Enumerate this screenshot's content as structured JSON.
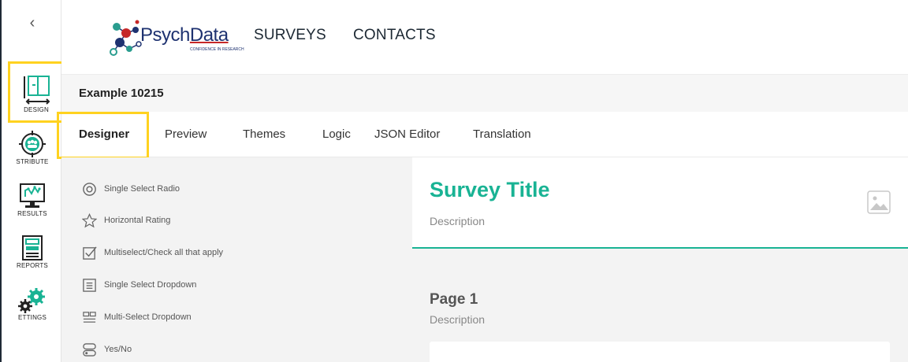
{
  "rail": {
    "collapse_glyph": "‹",
    "items": [
      {
        "label": "DESIGN",
        "icon": "design-icon"
      },
      {
        "label": "STRIBUTE",
        "icon": "distribute-icon"
      },
      {
        "label": "RESULTS",
        "icon": "results-icon"
      },
      {
        "label": "REPORTS",
        "icon": "reports-icon"
      },
      {
        "label": "ETTINGS",
        "icon": "settings-icon"
      }
    ]
  },
  "header": {
    "brand_prefix": "Psych",
    "brand_suffix": "Data",
    "tagline": "CONFIDENCE IN RESEARCH",
    "nav": [
      "SURVEYS",
      "CONTACTS"
    ]
  },
  "survey_name": "Example 10215",
  "tabs": [
    "Designer",
    "Preview",
    "Themes",
    "Logic",
    "JSON Editor",
    "Translation"
  ],
  "toolbox": [
    {
      "label": "Single Select Radio",
      "icon": "radio-icon"
    },
    {
      "label": "Horizontal Rating",
      "icon": "star-icon"
    },
    {
      "label": "Multiselect/Check all that apply",
      "icon": "checkbox-icon"
    },
    {
      "label": "Single Select Dropdown",
      "icon": "dropdown-icon"
    },
    {
      "label": "Multi-Select Dropdown",
      "icon": "multi-dropdown-icon"
    },
    {
      "label": "Yes/No",
      "icon": "toggle-icon"
    }
  ],
  "canvas": {
    "survey_title": "Survey Title",
    "survey_description": "Description",
    "page_title": "Page 1",
    "page_description": "Description"
  },
  "colors": {
    "accent": "#19b394",
    "highlight": "#ffd21f",
    "brand_navy": "#1e3270"
  }
}
